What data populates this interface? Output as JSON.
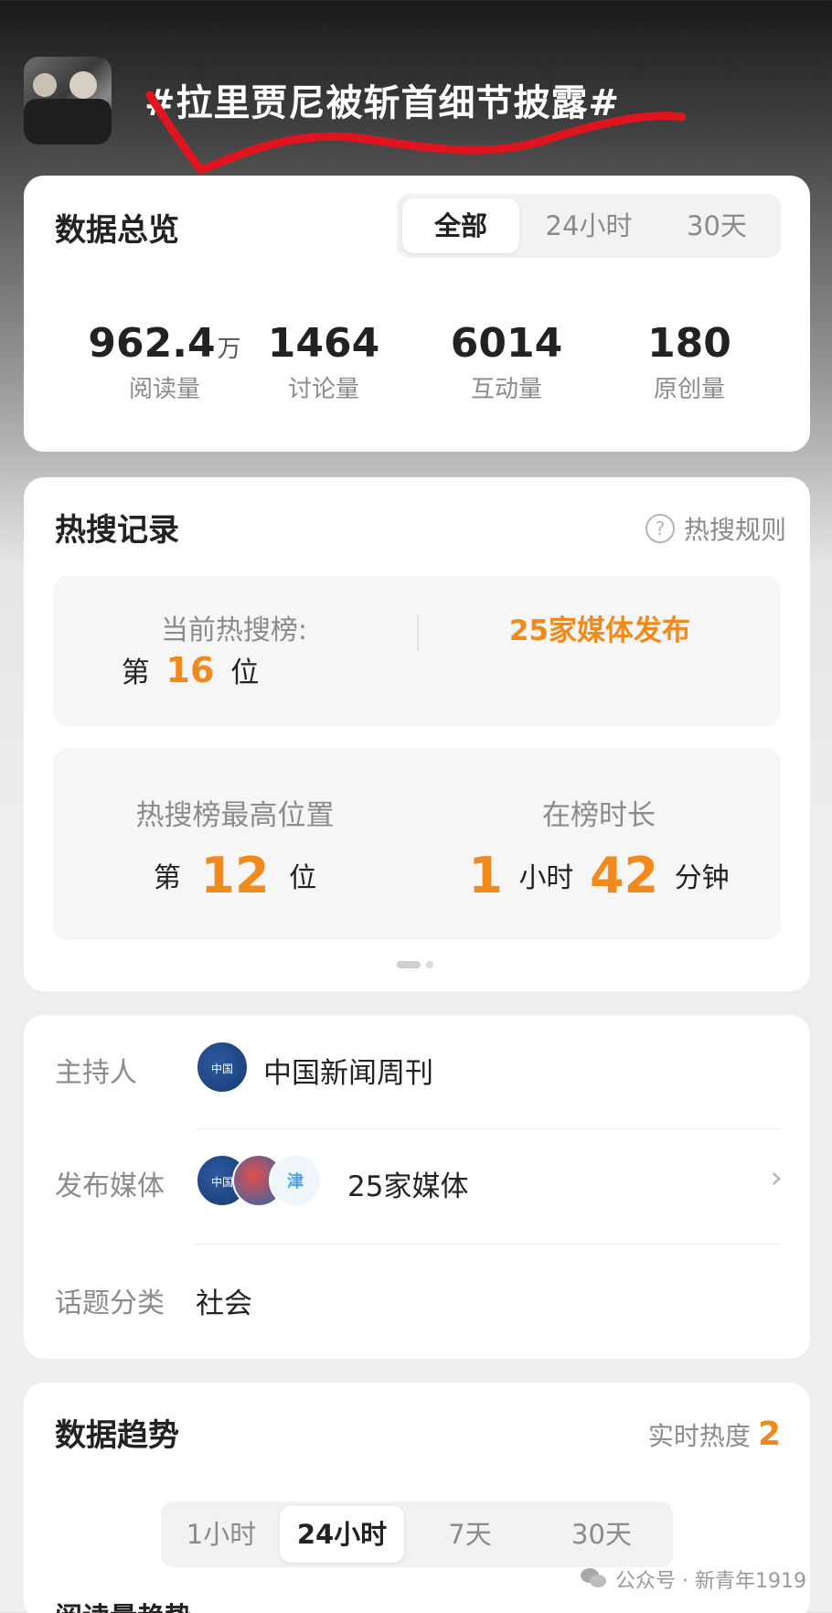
{
  "topic": {
    "title": "#拉里贾尼被斩首细节披露#"
  },
  "overview": {
    "title": "数据总览",
    "tabs": [
      "全部",
      "24小时",
      "30天"
    ],
    "active_tab": "全部",
    "stats": [
      {
        "value": "962.4",
        "unit": "万",
        "label": "阅读量"
      },
      {
        "value": "1464",
        "unit": "",
        "label": "讨论量"
      },
      {
        "value": "6014",
        "unit": "",
        "label": "互动量"
      },
      {
        "value": "180",
        "unit": "",
        "label": "原创量"
      }
    ]
  },
  "hot_record": {
    "title": "热搜记录",
    "rules_link": "热搜规则",
    "current_label": "当前热搜榜:",
    "current_prefix": "第",
    "current_rank": "16",
    "current_suffix": "位",
    "media_publish": "25家媒体发布",
    "highest_label": "热搜榜最高位置",
    "highest_prefix": "第",
    "highest_rank": "12",
    "highest_suffix": "位",
    "duration_label": "在榜时长",
    "duration_hours": "1",
    "duration_hours_unit": "小时",
    "duration_minutes": "42",
    "duration_minutes_unit": "分钟"
  },
  "info": {
    "host_label": "主持人",
    "host_name": "中国新闻周刊",
    "host_logo_text": "中国\n新闻周刊",
    "media_label": "发布媒体",
    "media_count": "25家媒体",
    "category_label": "话题分类",
    "category_value": "社会"
  },
  "trend": {
    "title": "数据趋势",
    "realtime_label": "实时热度",
    "realtime_value": "2",
    "tabs": [
      "1小时",
      "24小时",
      "7天",
      "30天"
    ],
    "active_tab": "24小时",
    "sub_title": "阅读量趋势"
  },
  "watermark": {
    "text": "公众号 · 新青年1919"
  },
  "colors": {
    "accent": "#f08a1c",
    "annotation": "#e0141e"
  }
}
